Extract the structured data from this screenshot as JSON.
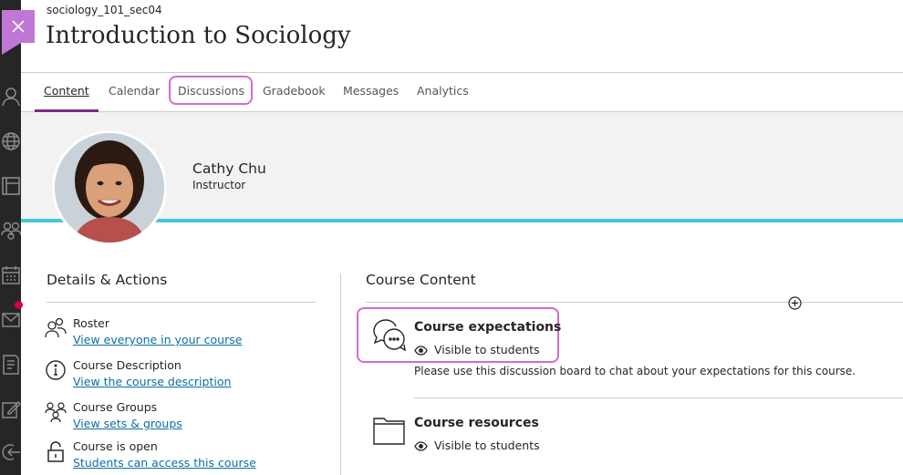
{
  "header": {
    "course_id": "sociology_101_sec04",
    "course_title": "Introduction to Sociology"
  },
  "tabs": [
    {
      "label": "Content",
      "active": true
    },
    {
      "label": "Calendar"
    },
    {
      "label": "Discussions",
      "highlighted": true
    },
    {
      "label": "Gradebook"
    },
    {
      "label": "Messages"
    },
    {
      "label": "Analytics"
    }
  ],
  "instructor": {
    "name": "Cathy Chu",
    "role": "Instructor"
  },
  "details": {
    "title": "Details & Actions",
    "items": [
      {
        "icon": "roster-icon",
        "title": "Roster",
        "link": "View everyone in your course"
      },
      {
        "icon": "info-icon",
        "title": "Course Description",
        "link": "View the course description"
      },
      {
        "icon": "groups-icon",
        "title": "Course Groups",
        "link": "View sets & groups"
      },
      {
        "icon": "unlock-icon",
        "title": "Course is open",
        "link": "Students can access this course"
      }
    ]
  },
  "course_content": {
    "title": "Course Content",
    "items": [
      {
        "icon": "discussion-icon",
        "title": "Course expectations",
        "visibility": "Visible to students",
        "description": "Please use this discussion board to chat about your expectations for this course."
      },
      {
        "icon": "folder-icon",
        "title": "Course resources",
        "visibility": "Visible to students"
      }
    ]
  },
  "colors": {
    "accent": "#7b2d86",
    "highlight": "#d36bcf",
    "banner_line": "#48c4e0",
    "link": "#0b6ea5",
    "close": "#c177d6"
  }
}
